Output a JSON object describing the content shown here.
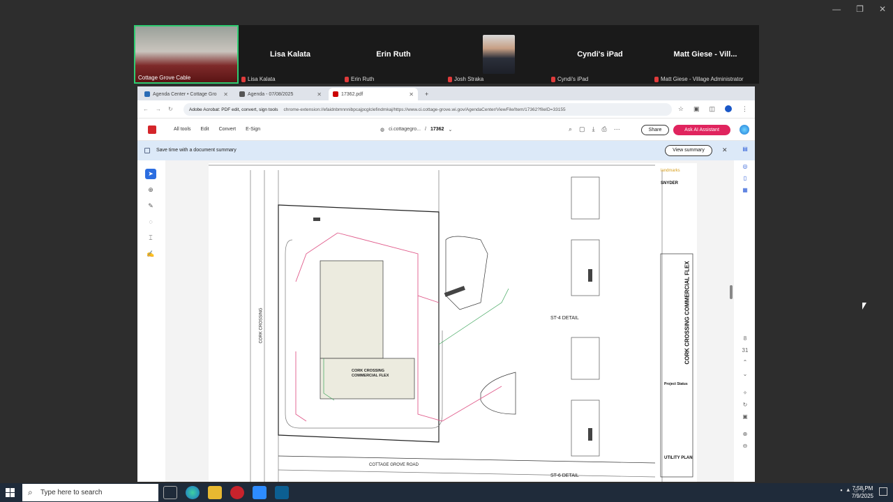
{
  "window_controls": [
    "—",
    "❐",
    "✕"
  ],
  "participants": [
    {
      "name": "Cottage Grove Cable",
      "display": ""
    },
    {
      "name": "Lisa Kalata",
      "display": "Lisa Kalata"
    },
    {
      "name": "Erin Ruth",
      "display": "Erin Ruth"
    },
    {
      "name": "Josh Straka",
      "display": ""
    },
    {
      "name": "Cyndi's iPad",
      "display": "Cyndi's iPad"
    },
    {
      "name": "Matt Giese - Village Administrator",
      "display": "Matt Giese - Vill..."
    }
  ],
  "browser": {
    "tabs": [
      {
        "label": "Agenda Center • Cottage Gro"
      },
      {
        "label": "Agenda - 07/08/2025"
      },
      {
        "label": "17362.pdf"
      }
    ],
    "new_tab": "+",
    "site_label": "Adobe Acrobat: PDF edit, convert, sign tools",
    "url": "chrome-extension://efaidnbmnnnibpcajpcglclefindmkaj/https://www.ci.cottage-grove.wi.gov/AgendaCenter/ViewFile/Item/17362?fileID=33155"
  },
  "acrobat": {
    "menu": [
      "All tools",
      "Edit",
      "Convert",
      "E-Sign"
    ],
    "file_host": "ci.cottagegro...",
    "file_sep": "/",
    "file_name": "17362",
    "share_label": "Share",
    "ai_label": "Ask AI Assistant",
    "banner_text": "Save time with a document summary",
    "summary_label": "View summary",
    "banner_close": "✕"
  },
  "drawing": {
    "road_label": "COTTAGE GROVE ROAD",
    "street_label": "CORK CROSSING",
    "building_label_1": "CORK CROSSING",
    "building_label_2": "COMMERCIAL FLEX",
    "detail_1": "ST-4 DETAIL",
    "detail_2": "ST-6 DETAIL",
    "title_block": "CORK CROSSING COMMERCIAL FLEX",
    "project_status": "Project Status",
    "sheet_title": "UTILITY PLAN",
    "brand_1": "landmarks",
    "brand_2": "SNYDER"
  },
  "taskbar": {
    "search_placeholder": "Type here to search",
    "time": "7:58 PM",
    "date": "7/9/2025"
  }
}
